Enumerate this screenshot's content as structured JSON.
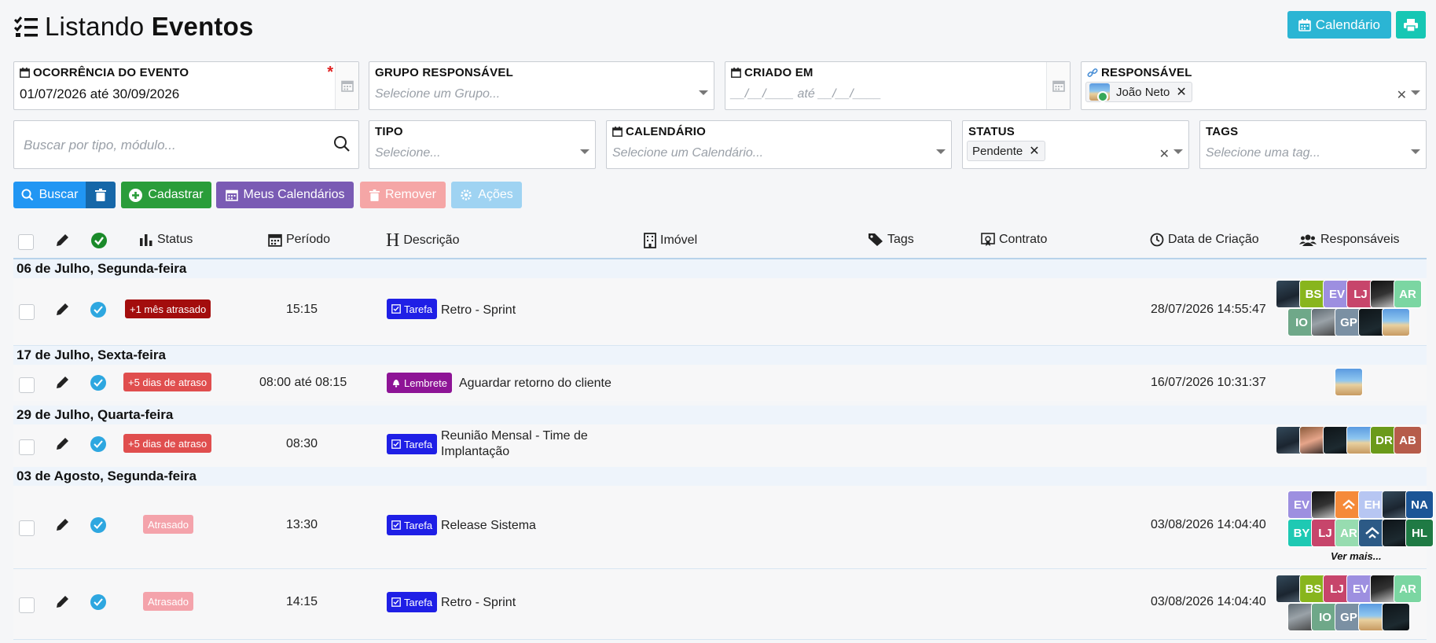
{
  "header": {
    "title_light": "Listando",
    "title_bold": "Eventos",
    "calendar_button": "Calendário",
    "print_icon": "print-icon"
  },
  "filters": {
    "ocorrencia": {
      "label": "OCORRÊNCIA DO EVENTO",
      "value": "01/07/2026 até 30/09/2026",
      "required": "*"
    },
    "grupo": {
      "label": "GRUPO RESPONSÁVEL",
      "placeholder": "Selecione um Grupo..."
    },
    "criado": {
      "label": "CRIADO EM",
      "placeholder": "__/__/____ até __/__/____"
    },
    "responsavel": {
      "label": "RESPONSÁVEL",
      "chip": "João Neto"
    },
    "busca": {
      "placeholder": "Buscar por tipo, módulo..."
    },
    "tipo": {
      "label": "TIPO",
      "placeholder": "Selecione..."
    },
    "calendario": {
      "label": "CALENDÁRIO",
      "placeholder": "Selecione um Calendário..."
    },
    "status": {
      "label": "STATUS",
      "chip": "Pendente"
    },
    "tags": {
      "label": "TAGS",
      "placeholder": "Selecione uma tag..."
    }
  },
  "actions": {
    "buscar": "Buscar",
    "cadastrar": "Cadastrar",
    "meus_calendarios": "Meus Calendários",
    "remover": "Remover",
    "acoes": "Ações"
  },
  "table": {
    "columns": {
      "status": "Status",
      "periodo": "Período",
      "descricao": "Descrição",
      "imovel": "Imóvel",
      "tags": "Tags",
      "contrato": "Contrato",
      "data_criacao": "Data de Criação",
      "responsaveis": "Responsáveis"
    },
    "groups": [
      {
        "title": "06 de Julho, Segunda-feira"
      },
      {
        "title": "17 de Julho, Sexta-feira"
      },
      {
        "title": "29 de Julho, Quarta-feira"
      },
      {
        "title": "03 de Agosto, Segunda-feira"
      }
    ],
    "rows": [
      {
        "status": "+1 mês atrasado",
        "status_color": "#a30d0d",
        "periodo": "15:15",
        "type": "Tarefa",
        "type_color": "#1f1fe6",
        "descricao": "Retro - Sprint",
        "criacao": "28/07/2026 14:55:47",
        "avatars": [
          "",
          "BS",
          "EV",
          "LJ",
          "",
          "AR",
          "IO",
          "",
          "GP",
          "",
          ""
        ]
      },
      {
        "status": "+5 dias de atraso",
        "status_color": "#e04e4e",
        "periodo": "08:00 até 08:15",
        "type": "Lembrete",
        "type_color": "#8e1496",
        "descricao": "Aguardar retorno do cliente",
        "criacao": "16/07/2026 10:31:37",
        "avatars": [
          ""
        ]
      },
      {
        "status": "+5 dias de atraso",
        "status_color": "#e04e4e",
        "periodo": "08:30",
        "type": "Tarefa",
        "type_color": "#1f1fe6",
        "descricao_l1": "Reunião Mensal - Time de",
        "descricao_l2": "Implantação",
        "criacao": "",
        "avatars": [
          "",
          "",
          "",
          "",
          "DR",
          "AB"
        ]
      },
      {
        "status": "Atrasado",
        "status_color": "#f4a3ab",
        "periodo": "13:30",
        "type": "Tarefa",
        "type_color": "#1f1fe6",
        "descricao": "Release Sistema",
        "criacao": "03/08/2026 14:04:40",
        "avatars": [
          "EV",
          "",
          "",
          "EH",
          "",
          "NA",
          "BY",
          "LJ",
          "AR",
          "",
          "",
          "HL"
        ],
        "ver_mais": "Ver mais..."
      },
      {
        "status": "Atrasado",
        "status_color": "#f4a3ab",
        "periodo": "14:15",
        "type": "Tarefa",
        "type_color": "#1f1fe6",
        "descricao": "Retro - Sprint",
        "criacao": "03/08/2026 14:04:40",
        "avatars": [
          "",
          "BS",
          "LJ",
          "EV",
          "",
          "AR",
          "",
          "IO",
          "GP",
          "",
          ""
        ]
      }
    ]
  },
  "colors": {
    "accent": "#2196f3",
    "cadastrar": "#2a9d3a",
    "meus": "#7a5bb4",
    "remover": "#f5a6a6",
    "acoes": "#9fd3f2"
  }
}
